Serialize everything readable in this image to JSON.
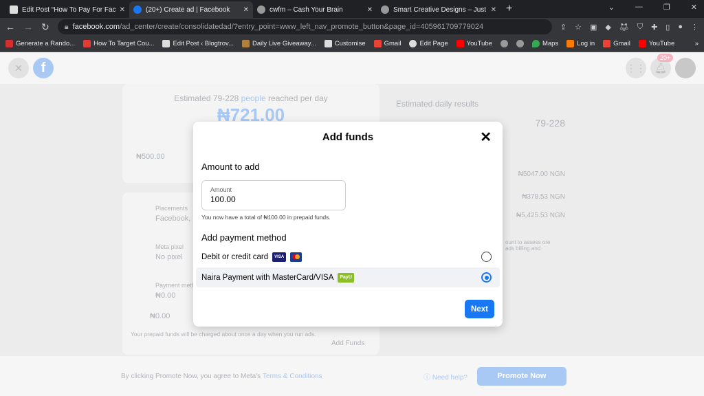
{
  "browser": {
    "tabs": [
      {
        "title": "Edit Post “How To Pay For Facebo"
      },
      {
        "title": "(20+) Create ad | Facebook",
        "active": true
      },
      {
        "title": "cwfm – Cash Your Brain"
      },
      {
        "title": "Smart Creative Designs – Just an"
      }
    ],
    "url_domain": "facebook.com",
    "url_path": "/ad_center/create/consolidatedad/?entry_point=www_left_nav_promote_button&page_id=405961709779024",
    "bookmarks": [
      "Generate a Rando...",
      "How To Target Cou...",
      "Edit Post ‹ Blogtrov...",
      "Daily Live Giveaway...",
      "Customise",
      "Gmail",
      "Edit Page",
      "YouTube",
      "",
      "",
      "Maps",
      "Log in",
      "Gmail",
      "YouTube"
    ]
  },
  "header": {
    "notification_badge": "20+"
  },
  "background": {
    "estimate": "Estimated 79-228",
    "estimate_link": "people",
    "estimate_tail": "reached per day",
    "budget_big": "₦721.00",
    "budget_min": "₦500.00",
    "placements_label": "Placements",
    "placements_value": "Facebook,",
    "pixel_label": "Meta pixel",
    "pixel_value": "No pixel",
    "payment_label": "Payment meth",
    "payment_value": "₦0.00",
    "prepaid_value": "₦0.00",
    "prepaid_note": "Your prepaid funds will be charged about once a day when you run ads.",
    "add_funds": "Add Funds",
    "results_title": "Estimated daily results",
    "results_value": "79-228",
    "cost1": "₦5047.00 NGN",
    "cost2": "₦378.53 NGN",
    "cost3": "₦5,425.53 NGN",
    "side_note": "ount to assess ore ads billing and"
  },
  "footer": {
    "agree": "By clicking Promote Now, you agree to Meta's",
    "terms": "Terms & Conditions",
    "help": "Need help?",
    "promote": "Promote Now"
  },
  "modal": {
    "title": "Add funds",
    "amount_heading": "Amount to add",
    "amount_label": "Amount",
    "amount_value": "100.00",
    "hint": "You now have a total of ₦100.00 in prepaid funds.",
    "method_heading": "Add payment method",
    "options": [
      {
        "label": "Debit or credit card",
        "selected": false,
        "badges": [
          "VISA",
          "MC"
        ]
      },
      {
        "label": "Naira Payment with MasterCard/VISA",
        "selected": true,
        "badges": [
          "PayU"
        ]
      }
    ],
    "next": "Next"
  },
  "colors": {
    "accent": "#1877f2",
    "payu": "#8cbf26",
    "visa": "#1a1f71"
  }
}
